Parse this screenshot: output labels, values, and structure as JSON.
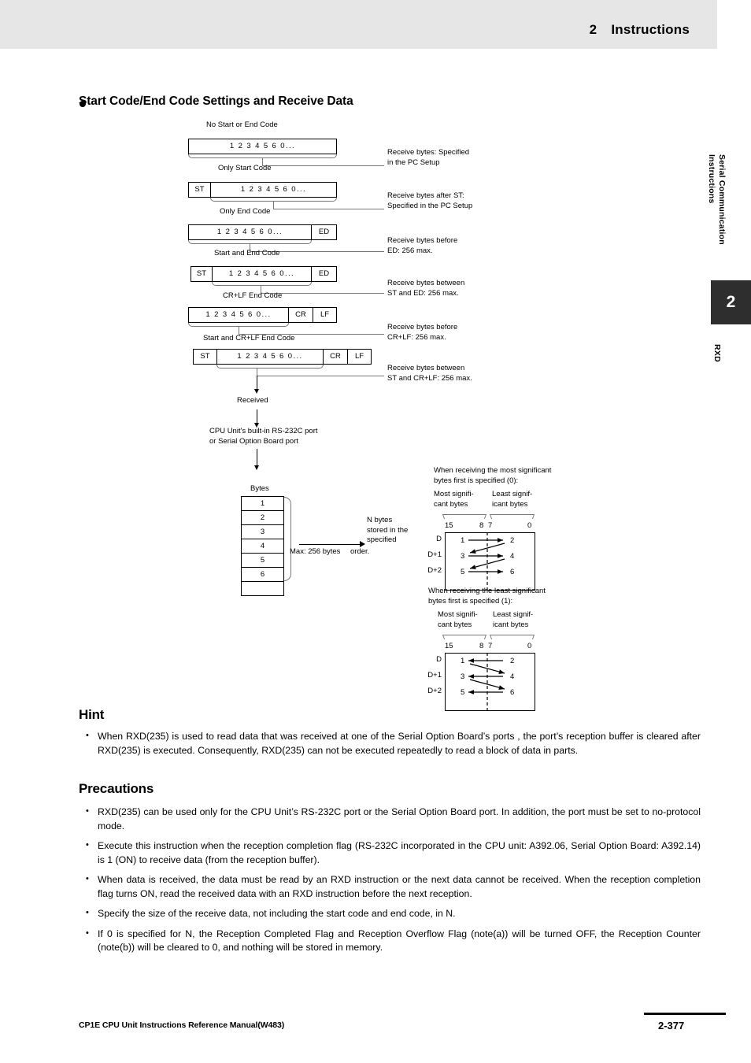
{
  "header": {
    "chapter_number": "2",
    "chapter_title": "Instructions"
  },
  "side_tab": {
    "group_label": "Serial Communication Instructions",
    "chapter_number": "2",
    "instruction_label": "RXD"
  },
  "section": {
    "bullet_icon": "filled-circle-bullet",
    "heading": "Start Code/End Code Settings and Receive Data"
  },
  "frame_diagram": {
    "cases": [
      {
        "caption": "No Start or End Code",
        "start_code": null,
        "payload": "1 2 3 4 5 6 0...",
        "end_codes": [],
        "note": "Receive bytes: Specified in the PC Setup",
        "note_line1": "Receive bytes: Specified",
        "note_line2": "in the PC Setup"
      },
      {
        "caption": "Only Start Code",
        "start_code": "ST",
        "payload": "1 2 3 4 5 6 0...",
        "end_codes": [],
        "note": "Receive bytes after ST: Specified in the PC Setup",
        "note_line1": "Receive bytes after ST:",
        "note_line2": "Specified in the PC Setup"
      },
      {
        "caption": "Only End Code",
        "start_code": null,
        "payload": "1 2 3 4 5 6 0...",
        "end_codes": [
          "ED"
        ],
        "note": "Receive bytes before ED: 256 max.",
        "note_line1": "Receive bytes before",
        "note_line2": "ED: 256 max."
      },
      {
        "caption": "Start and End Code",
        "start_code": "ST",
        "payload": "1 2 3 4 5 6 0...",
        "end_codes": [
          "ED"
        ],
        "note": "Receive bytes between ST and ED: 256 max.",
        "note_line1": "Receive bytes between",
        "note_line2": "ST and ED: 256 max."
      },
      {
        "caption": "CR+LF End Code",
        "start_code": null,
        "payload": "1 2 3 4 5 6 0...",
        "end_codes": [
          "CR",
          "LF"
        ],
        "note": "Receive bytes before CR+LF: 256 max.",
        "note_line1": "Receive bytes before",
        "note_line2": "CR+LF: 256 max."
      },
      {
        "caption": "Start and CR+LF End Code",
        "start_code": "ST",
        "payload": "1 2 3 4 5 6 0...",
        "end_codes": [
          "CR",
          "LF"
        ],
        "note": "Receive bytes between ST and CR+LF: 256 max.",
        "note_line1": "Receive bytes between",
        "note_line2": "ST and CR+LF: 256 max."
      }
    ],
    "received_label": "Received",
    "port_line1": "CPU Unit's built-in RS-232C port",
    "port_line2": "or Serial Option Board port"
  },
  "byte_stack": {
    "title": "Bytes",
    "values": [
      "1",
      "2",
      "3",
      "4",
      "5",
      "6",
      ""
    ],
    "max_label": "Max: 256 bytes",
    "arrow_note_line1": "N bytes",
    "arrow_note_line2": "stored in the",
    "arrow_note_line3": "specified",
    "arrow_note_line4": "order."
  },
  "memory_maps": [
    {
      "title_line1": "When receiving the most significant",
      "title_line2": "bytes first is specified (0):",
      "msb_label_line1": "Most signifi-",
      "msb_label_line2": "cant bytes",
      "lsb_label_line1": "Least signif-",
      "lsb_label_line2": "icant bytes",
      "bit_labels": [
        "15",
        "8",
        "7",
        "0"
      ],
      "rows": [
        {
          "address": "D",
          "high_byte": "1",
          "low_byte": "2"
        },
        {
          "address": "D+1",
          "high_byte": "3",
          "low_byte": "4"
        },
        {
          "address": "D+2",
          "high_byte": "5",
          "low_byte": "6"
        },
        {
          "address": "",
          "high_byte": "",
          "low_byte": ""
        }
      ],
      "order": "most-significant-first"
    },
    {
      "title_line1": "When receiving the least significant",
      "title_line2": "bytes first is specified (1):",
      "msb_label_line1": "Most signifi-",
      "msb_label_line2": "cant bytes",
      "lsb_label_line1": "Least signif-",
      "lsb_label_line2": "icant bytes",
      "bit_labels": [
        "15",
        "8",
        "7",
        "0"
      ],
      "rows": [
        {
          "address": "D",
          "high_byte": "1",
          "low_byte": "2"
        },
        {
          "address": "D+1",
          "high_byte": "3",
          "low_byte": "4"
        },
        {
          "address": "D+2",
          "high_byte": "5",
          "low_byte": "6"
        },
        {
          "address": "",
          "high_byte": "",
          "low_byte": ""
        }
      ],
      "order": "least-significant-first"
    }
  ],
  "hint": {
    "heading": "Hint",
    "items": [
      "When RXD(235) is used to read data that was received at one of the Serial Option Board’s ports , the port’s reception buffer is cleared after RXD(235) is executed. Consequently, RXD(235) can not be executed repeatedly to read a block of data in parts."
    ]
  },
  "precautions": {
    "heading": "Precautions",
    "items": [
      "RXD(235) can be used only for the CPU Unit’s RS-232C port or the Serial Option Board port. In addition, the port must be set to no-protocol mode.",
      "Execute this instruction when the reception completion flag (RS-232C incorporated in the CPU unit: A392.06, Serial Option Board: A392.14) is 1 (ON) to receive data (from the reception buffer).",
      "When data is received, the data must be read by an RXD instruction or the next data cannot be received. When the reception completion flag turns ON, read the received data with an RXD instruction before the next reception.",
      "Specify the size of the receive data, not including the start code and end code, in N.",
      "If 0 is specified for N, the Reception Completed Flag and Reception Overflow Flag (note(a)) will be turned OFF, the Reception Counter (note(b)) will be cleared to 0, and nothing will be stored in memory."
    ]
  },
  "footer": {
    "manual_title": "CP1E CPU Unit Instructions Reference Manual(W483)",
    "page_number": "2-377"
  },
  "colors": {
    "header_band": "#e6e6e6",
    "tab_dark": "#2e2e2e",
    "rule": "#000000"
  }
}
